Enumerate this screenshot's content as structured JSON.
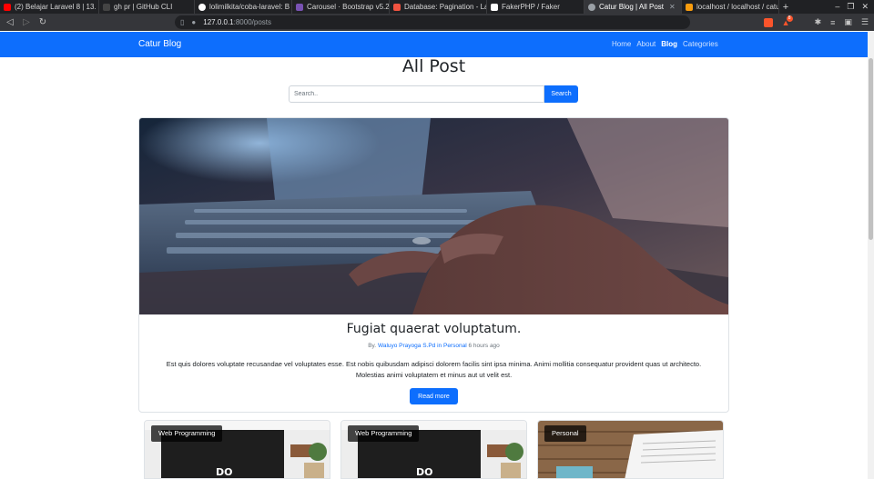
{
  "browser": {
    "tabs": [
      {
        "title": "(2) Belajar Laravel 8 | 13. S",
        "favicon_color": "#ff0000",
        "active": false
      },
      {
        "title": "gh pr | GitHub CLI",
        "favicon_color": "#202124",
        "active": false
      },
      {
        "title": "lolimilkita/coba-laravel: B",
        "favicon_color": "#ffffff",
        "active": false
      },
      {
        "title": "Carousel · Bootstrap v5.2",
        "favicon_color": "#7952b3",
        "active": false
      },
      {
        "title": "Database: Pagination - La",
        "favicon_color": "#f05340",
        "active": false
      },
      {
        "title": "FakerPHP / Faker",
        "favicon_color": "#ffffff",
        "active": false
      },
      {
        "title": "Catur Blog | All Post",
        "favicon_color": "#9aa0a6",
        "active": true
      },
      {
        "title": "localhost / localhost / catu",
        "favicon_color": "#f89c0e",
        "active": false
      }
    ],
    "new_tab": "+",
    "url_host": "127.0.0.1",
    "url_path": ":8000/posts",
    "badge_count": "8"
  },
  "navbar": {
    "brand": "Catur Blog",
    "links": [
      {
        "label": "Home",
        "active": false
      },
      {
        "label": "About",
        "active": false
      },
      {
        "label": "Blog",
        "active": true
      },
      {
        "label": "Categories",
        "active": false
      }
    ]
  },
  "main": {
    "title": "All Post",
    "search": {
      "placeholder": "Search..",
      "button": "Search"
    },
    "hero": {
      "title": "Fugiat quaerat voluptatum.",
      "by": "By.",
      "author": "Waluyo Prayoga S.Pd",
      "in": "in",
      "category": "Personal",
      "time": "6 hours ago",
      "excerpt": "Est quis dolores voluptate recusandae vel voluptates esse. Est nobis quibusdam adipisci dolorem facilis sint ipsa minima. Animi mollitia consequatur provident quas ut architecto. Molestias animi voluptatem et minus aut ut velit est.",
      "read_more": "Read more"
    },
    "cards": [
      {
        "category": "Web Programming"
      },
      {
        "category": "Web Programming"
      },
      {
        "category": "Personal"
      }
    ]
  },
  "colors": {
    "primary": "#0d6efd",
    "chrome_dark": "#202124",
    "chrome_mid": "#35363a"
  }
}
